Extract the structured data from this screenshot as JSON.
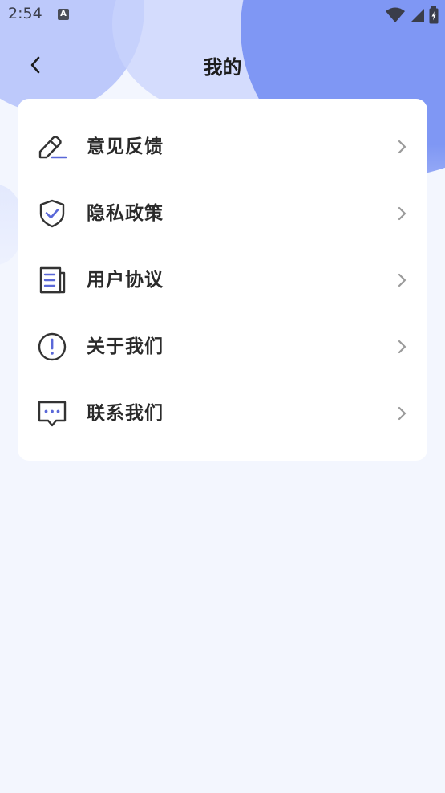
{
  "status_bar": {
    "time": "2:54",
    "notification_badge": "A"
  },
  "header": {
    "title": "我的"
  },
  "menu": {
    "items": [
      {
        "label": "意见反馈",
        "icon": "feedback-pencil-icon"
      },
      {
        "label": "隐私政策",
        "icon": "privacy-shield-icon"
      },
      {
        "label": "用户协议",
        "icon": "agreement-document-icon"
      },
      {
        "label": "关于我们",
        "icon": "about-exclamation-icon"
      },
      {
        "label": "联系我们",
        "icon": "contact-chat-icon"
      }
    ]
  },
  "colors": {
    "accent": "#5a68d8",
    "icon_stroke": "#333333",
    "chevron": "#9a9a9a",
    "card_bg": "#ffffff",
    "page_bg": "#f3f6fe"
  }
}
